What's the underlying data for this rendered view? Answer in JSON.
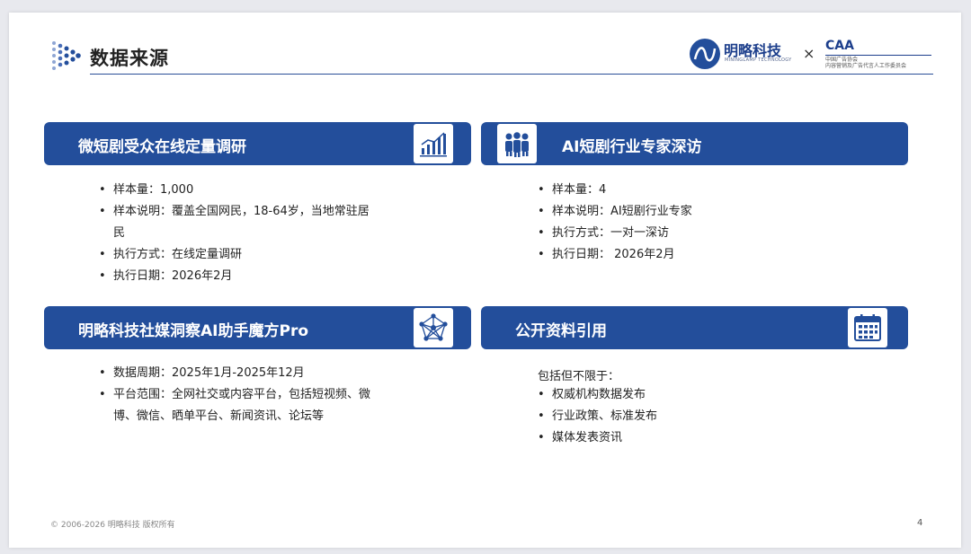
{
  "header": {
    "title": "数据来源",
    "brand_name": "明略科技",
    "brand_sub": "MININGLAMP TECHNOLOGY",
    "times": "×",
    "partner_logo": "CAA",
    "partner_line1": "中国广告协会",
    "partner_line2": "内容营销及广告代言人工作委员会"
  },
  "sections": [
    {
      "title": "微短剧受众在线定量调研",
      "icon": "bar-chart-icon",
      "items": [
        "样本量：1,000",
        "样本说明：覆盖全国网民，18-64岁，当地常驻居民",
        "执行方式：在线定量调研",
        "执行日期：2026年2月"
      ]
    },
    {
      "title": "AI短剧行业专家深访",
      "icon": "people-icon",
      "items": [
        "样本量：4",
        "样本说明：AI短剧行业专家",
        "执行方式：一对一深访",
        "执行日期： 2026年2月"
      ]
    },
    {
      "title": "明略科技社媒洞察AI助手魔方Pro",
      "icon": "network-icon",
      "items": [
        "数据周期：2025年1月-2025年12月",
        "平台范围：全网社交或内容平台，包括短视频、微博、微信、晒单平台、新闻资讯、论坛等"
      ]
    },
    {
      "title": "公开资料引用",
      "icon": "calendar-icon",
      "intro": "包括但不限于：",
      "items": [
        "权威机构数据发布",
        "行业政策、标准发布",
        "媒体发表资讯"
      ]
    }
  ],
  "footer": {
    "copyright": "© 2006-2026 明略科技 版权所有",
    "page": "4"
  },
  "colors": {
    "accent": "#234e9b",
    "text": "#222222"
  }
}
